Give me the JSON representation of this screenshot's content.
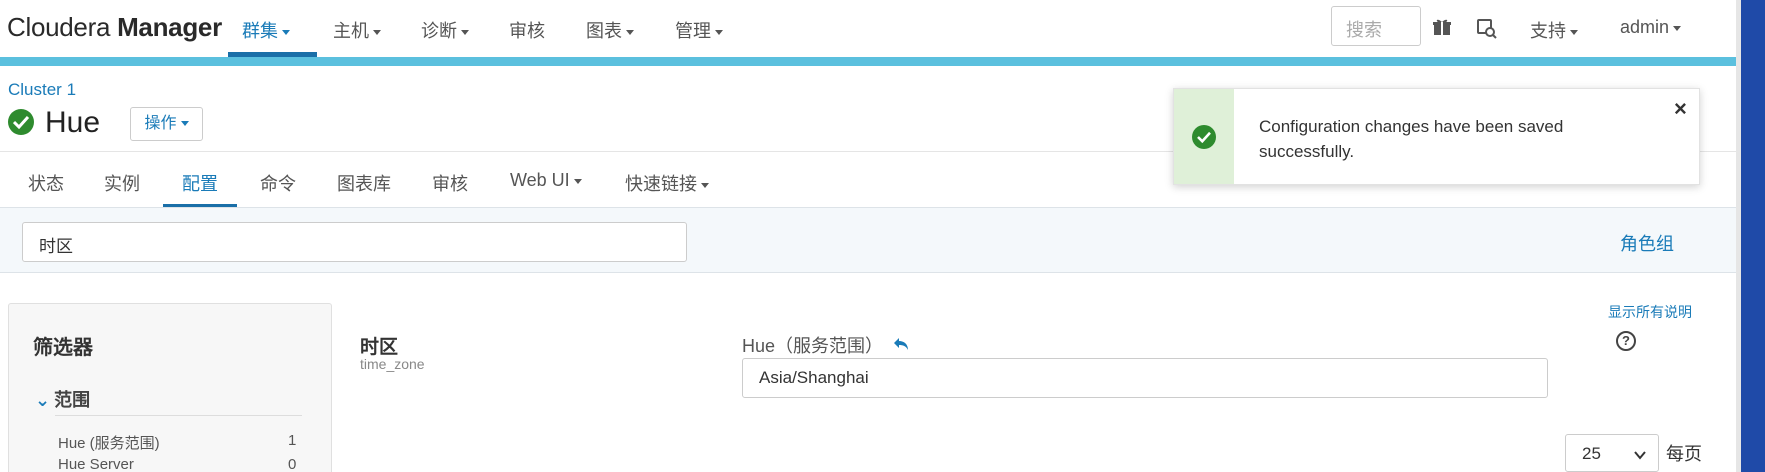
{
  "brand": {
    "part1": "Cloudera",
    "part2": "Manager"
  },
  "nav": {
    "items": [
      {
        "label": "群集",
        "active": true
      },
      {
        "label": "主机"
      },
      {
        "label": "诊断"
      },
      {
        "label": "审核"
      },
      {
        "label": "图表"
      },
      {
        "label": "管理"
      }
    ],
    "search_placeholder": "搜索",
    "support": "支持",
    "user": "admin"
  },
  "breadcrumb": {
    "cluster": "Cluster 1"
  },
  "service": {
    "name": "Hue",
    "status": "good",
    "actions_label": "操作"
  },
  "tabs": [
    {
      "label": "状态"
    },
    {
      "label": "实例"
    },
    {
      "label": "配置",
      "active": true
    },
    {
      "label": "命令"
    },
    {
      "label": "图表库"
    },
    {
      "label": "审核"
    },
    {
      "label": "Web UI"
    },
    {
      "label": "快速链接"
    }
  ],
  "config_search": {
    "value": "时区"
  },
  "role_group_link": "角色组",
  "filters": {
    "title": "筛选器",
    "range_heading": "范围",
    "rows": [
      {
        "label": "Hue (服务范围)",
        "count": "1"
      },
      {
        "label": "Hue Server",
        "count": "0"
      }
    ]
  },
  "property": {
    "name": "时区",
    "key": "time_zone",
    "scope": "Hue（服务范围）",
    "value": "Asia/Shanghai"
  },
  "show_all_desc": "显示所有说明",
  "pagination": {
    "per_page": "25",
    "per_page_label": "每页"
  },
  "toast": {
    "message": "Configuration changes have been saved successfully."
  },
  "colors": {
    "accent": "#1a7bb8",
    "band": "#5bc0de",
    "success": "#2e8b2e",
    "toast_side": "#dff0d8"
  }
}
